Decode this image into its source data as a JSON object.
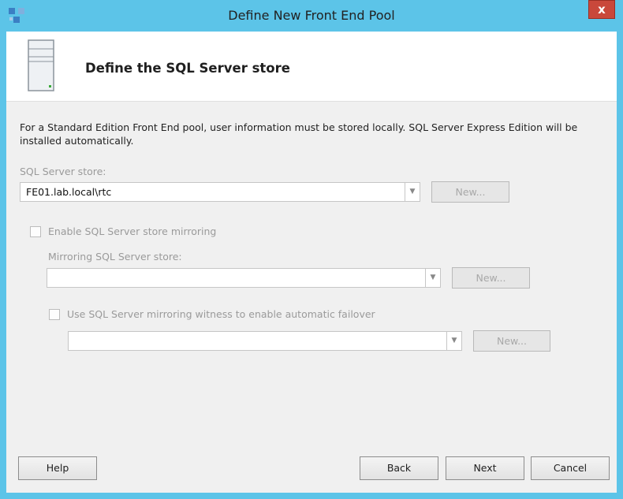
{
  "window": {
    "title": "Define New Front End Pool",
    "close_glyph": "x"
  },
  "header": {
    "title": "Define the SQL Server store",
    "icon": "server-icon"
  },
  "description": "For a Standard Edition Front End pool, user information must be stored locally.  SQL Server Express Edition will be installed automatically.",
  "sql_store": {
    "label": "SQL Server store:",
    "value": "FE01.lab.local\\rtc",
    "new_label": "New..."
  },
  "mirroring": {
    "checkbox_label": "Enable SQL Server store mirroring",
    "checked": false,
    "store_label": "Mirroring SQL Server store:",
    "store_value": "",
    "new_label": "New..."
  },
  "witness": {
    "checkbox_label": "Use SQL Server mirroring witness to enable automatic failover",
    "checked": false,
    "value": "",
    "new_label": "New..."
  },
  "footer": {
    "help": "Help",
    "back": "Back",
    "next": "Next",
    "cancel": "Cancel"
  },
  "colors": {
    "titlebar": "#5cc4e8",
    "close": "#c9483b",
    "client": "#f0f0f0",
    "disabled_text": "#9a9a9a"
  }
}
